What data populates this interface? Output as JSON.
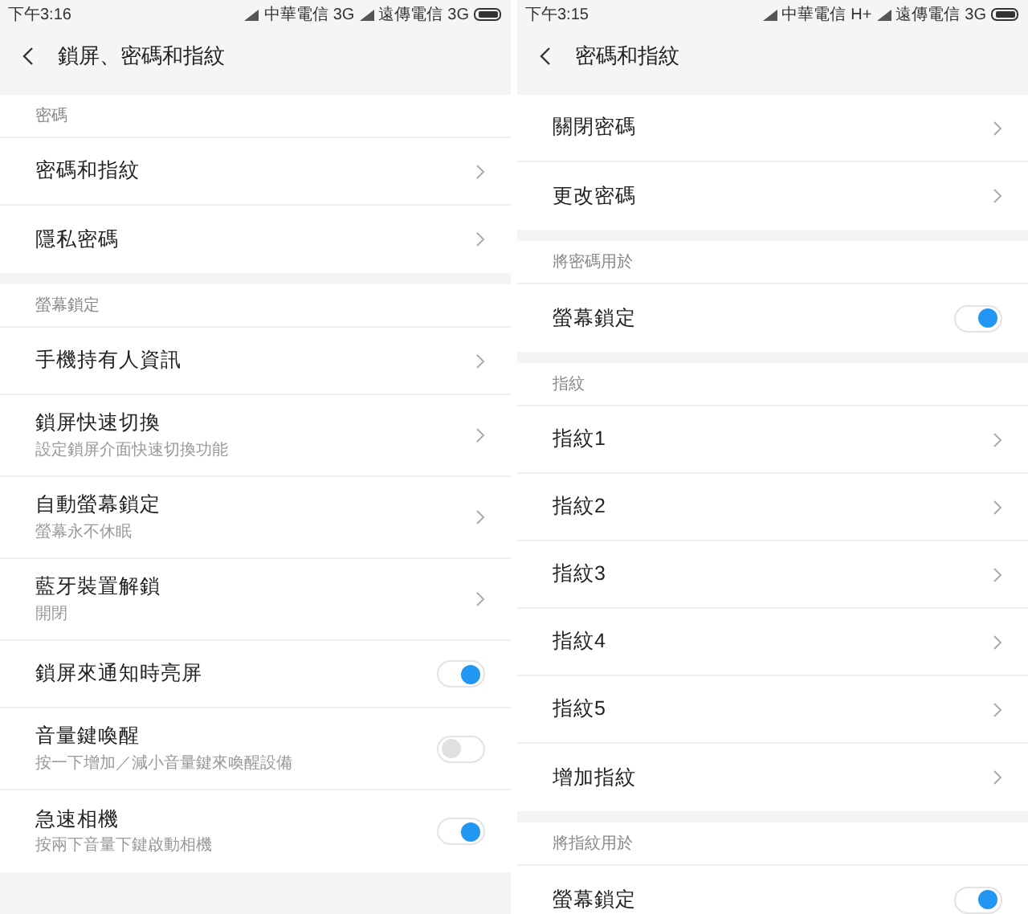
{
  "panels": [
    {
      "status_bar": {
        "time": "下午3:16",
        "carrier_1": "中華電信",
        "network_1": "3G",
        "carrier_2": "遠傳電信",
        "network_2": "3G"
      },
      "header": {
        "title": "鎖屏、密碼和指紋"
      },
      "sections": [
        {
          "label": "密碼",
          "items": [
            {
              "kind": "link",
              "title": "密碼和指紋"
            },
            {
              "kind": "link",
              "title": "隱私密碼"
            }
          ]
        },
        {
          "label": "螢幕鎖定",
          "items": [
            {
              "kind": "link",
              "title": "手機持有人資訊"
            },
            {
              "kind": "link",
              "title": "鎖屏快速切換",
              "subtitle": "設定鎖屏介面快速切換功能"
            },
            {
              "kind": "link",
              "title": "自動螢幕鎖定",
              "subtitle": "螢幕永不休眠"
            },
            {
              "kind": "link",
              "title": "藍牙裝置解鎖",
              "subtitle": "開閉"
            },
            {
              "kind": "toggle",
              "title": "鎖屏來通知時亮屏",
              "on": true
            },
            {
              "kind": "toggle",
              "title": "音量鍵喚醒",
              "subtitle": "按一下增加／減小音量鍵來喚醒設備",
              "on": false
            },
            {
              "kind": "toggle",
              "title": "急速相機",
              "subtitle": "按兩下音量下鍵啟動相機",
              "on": true
            }
          ]
        }
      ]
    },
    {
      "status_bar": {
        "time": "下午3:15",
        "carrier_1": "中華電信",
        "network_1": "H+",
        "carrier_2": "遠傳電信",
        "network_2": "3G"
      },
      "header": {
        "title": "密碼和指紋"
      },
      "sections": [
        {
          "items": [
            {
              "kind": "link",
              "title": "關閉密碼"
            },
            {
              "kind": "link",
              "title": "更改密碼"
            }
          ]
        },
        {
          "label": "將密碼用於",
          "items": [
            {
              "kind": "toggle",
              "title": "螢幕鎖定",
              "on": true
            }
          ]
        },
        {
          "label": "指紋",
          "items": [
            {
              "kind": "link",
              "title": "指紋1"
            },
            {
              "kind": "link",
              "title": "指紋2"
            },
            {
              "kind": "link",
              "title": "指紋3"
            },
            {
              "kind": "link",
              "title": "指紋4"
            },
            {
              "kind": "link",
              "title": "指紋5"
            },
            {
              "kind": "link",
              "title": "增加指紋"
            }
          ]
        },
        {
          "label": "將指紋用於",
          "items": [
            {
              "kind": "toggle",
              "title": "螢幕鎖定",
              "on": true
            }
          ]
        }
      ]
    }
  ]
}
